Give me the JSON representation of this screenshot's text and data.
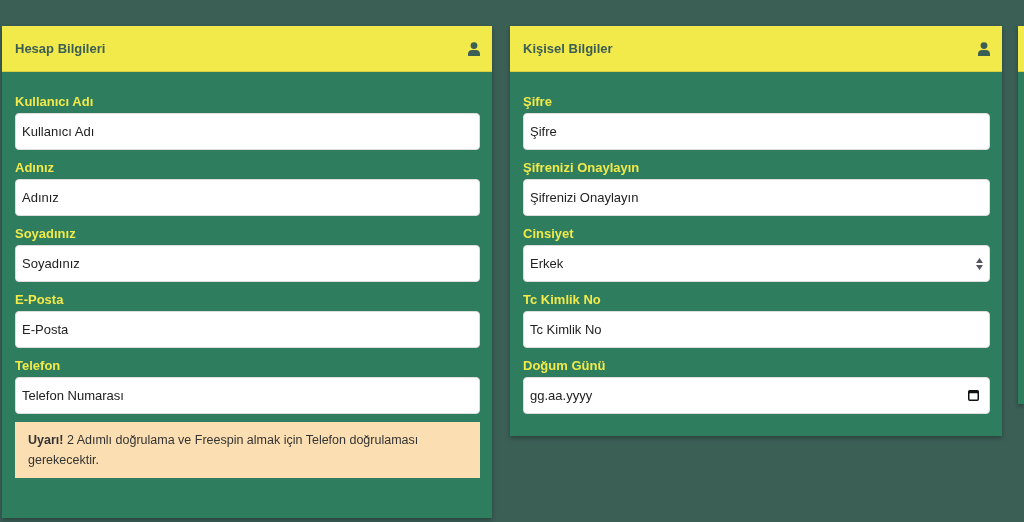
{
  "cards": [
    {
      "title": "Hesap Bilgileri",
      "fields": [
        {
          "kind": "text",
          "label": "Kullanıcı Adı",
          "placeholder": "Kullanıcı Adı"
        },
        {
          "kind": "text",
          "label": "Adınız",
          "placeholder": "Adınız"
        },
        {
          "kind": "text",
          "label": "Soyadınız",
          "placeholder": "Soyadınız"
        },
        {
          "kind": "text",
          "label": "E-Posta",
          "placeholder": "E-Posta"
        },
        {
          "kind": "text",
          "label": "Telefon",
          "placeholder": "Telefon Numarası"
        }
      ],
      "alert": "**Uyarı!** 2 Adımlı doğrulama ve Freespin almak için Telefon doğrulaması gerekecektir."
    },
    {
      "title": "Kişisel Bilgiler",
      "fields": [
        {
          "kind": "text",
          "label": "Şifre",
          "placeholder": "Şifre"
        },
        {
          "kind": "text",
          "label": "Şifrenizi Onaylayın",
          "placeholder": "Şifrenizi Onaylayın"
        },
        {
          "kind": "select",
          "label": "Cinsiyet",
          "value": "Erkek"
        },
        {
          "kind": "text",
          "label": "Tc Kimlik No",
          "placeholder": "Tc Kimlik No"
        },
        {
          "kind": "date",
          "label": "Doğum Günü",
          "placeholder": "gg.aa.yyyy"
        }
      ]
    }
  ]
}
